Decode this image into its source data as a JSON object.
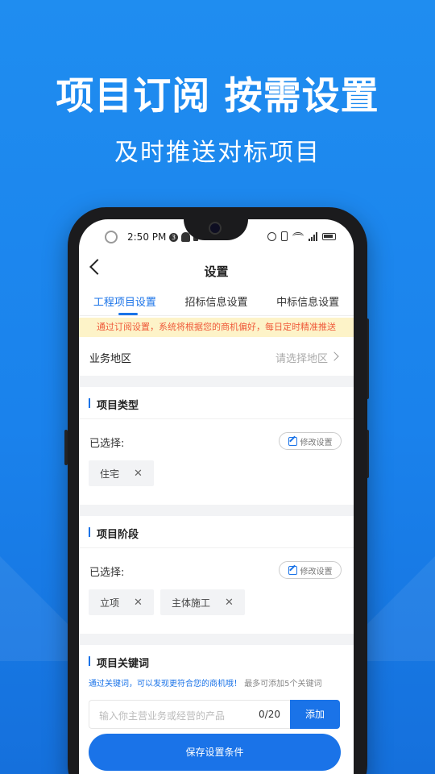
{
  "hero": {
    "title": "项目订阅 按需设置",
    "subtitle": "及时推送对标项目"
  },
  "status_bar": {
    "time": "2:50 PM",
    "badge": "3"
  },
  "nav": {
    "title": "设置"
  },
  "tabs": [
    {
      "label": "工程项目设置",
      "active": true
    },
    {
      "label": "招标信息设置",
      "active": false
    },
    {
      "label": "中标信息设置",
      "active": false
    }
  ],
  "notice": "通过订阅设置，系统将根据您的商机偏好，每日定时精准推送",
  "region": {
    "label": "业务地区",
    "placeholder": "请选择地区"
  },
  "project_type": {
    "title": "项目类型",
    "selected_label": "已选择:",
    "edit_label": "修改设置",
    "chips": [
      "住宅"
    ]
  },
  "project_stage": {
    "title": "项目阶段",
    "selected_label": "已选择:",
    "edit_label": "修改设置",
    "chips": [
      "立项",
      "主体施工"
    ]
  },
  "keywords": {
    "title": "项目关键词",
    "hint_blue": "通过关键词，可以发现更符合您的商机哦！",
    "hint_gray": "最多可添加5个关键词",
    "input_placeholder": "输入你主营业务或经营的产品",
    "counter": "0/20",
    "add_label": "添加"
  },
  "save_label": "保存设置条件",
  "colors": {
    "background": "#1a82ec",
    "accent": "#1a73e8",
    "notice_bg": "#fdf3c8",
    "notice_text": "#ef5a3a"
  }
}
